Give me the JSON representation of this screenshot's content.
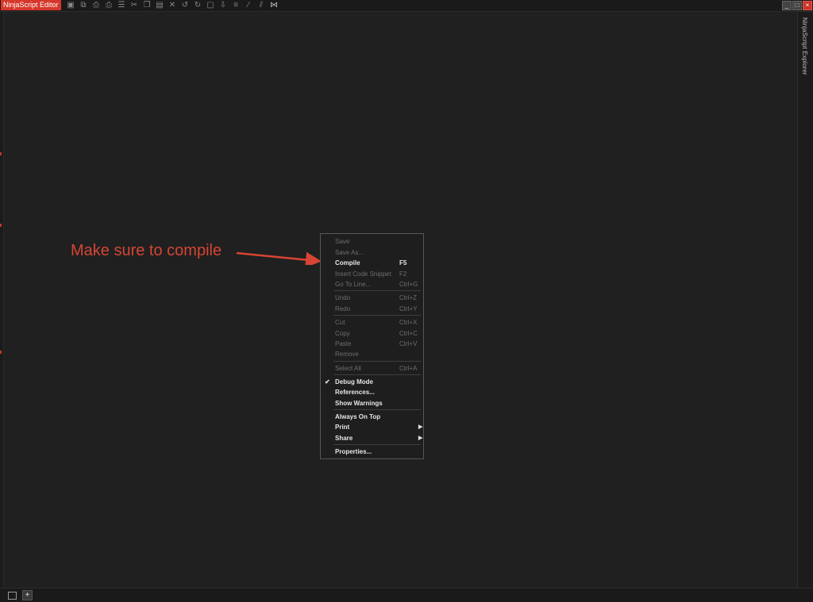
{
  "titlebar": {
    "app_title": "NinjaScript Editor",
    "toolbar_icons": [
      "save-icon",
      "save-all-icon",
      "print-icon",
      "print-preview-icon",
      "document-icon",
      "cut-icon",
      "copy-icon",
      "paste-icon",
      "delete-icon",
      "undo-icon",
      "redo-icon",
      "new-doc-icon",
      "insert-icon",
      "indent-icon",
      "comment-icon",
      "uncomment-icon",
      "visual-studio-icon"
    ]
  },
  "right_panel": {
    "tab_label": "NinjaScript Explorer"
  },
  "annotation": {
    "text": "Make sure to compile",
    "color": "#d64533"
  },
  "context_menu": {
    "items": [
      {
        "label": "Save",
        "shortcut": "",
        "enabled": false
      },
      {
        "label": "Save As...",
        "shortcut": "",
        "enabled": false
      },
      {
        "label": "Compile",
        "shortcut": "F5",
        "enabled": true
      },
      {
        "label": "Insert Code Snippet",
        "shortcut": "F2",
        "enabled": false
      },
      {
        "label": "Go To Line...",
        "shortcut": "Ctrl+G",
        "enabled": false
      },
      {
        "label": "Undo",
        "shortcut": "Ctrl+Z",
        "enabled": false
      },
      {
        "label": "Redo",
        "shortcut": "Ctrl+Y",
        "enabled": false
      },
      {
        "label": "Cut",
        "shortcut": "Ctrl+X",
        "enabled": false
      },
      {
        "label": "Copy",
        "shortcut": "Ctrl+C",
        "enabled": false
      },
      {
        "label": "Paste",
        "shortcut": "Ctrl+V",
        "enabled": false
      },
      {
        "label": "Remove",
        "shortcut": "",
        "enabled": false
      },
      {
        "label": "Select All",
        "shortcut": "Ctrl+A",
        "enabled": false
      },
      {
        "label": "Debug Mode",
        "shortcut": "",
        "enabled": true,
        "checked": true
      },
      {
        "label": "References...",
        "shortcut": "",
        "enabled": true
      },
      {
        "label": "Show Warnings",
        "shortcut": "",
        "enabled": true
      },
      {
        "label": "Always On Top",
        "shortcut": "",
        "enabled": true
      },
      {
        "label": "Print",
        "shortcut": "",
        "enabled": true,
        "submenu": true
      },
      {
        "label": "Share",
        "shortcut": "",
        "enabled": true,
        "submenu": true
      },
      {
        "label": "Properties...",
        "shortcut": "",
        "enabled": true
      }
    ]
  },
  "colors": {
    "accent": "#d7372b",
    "background": "#202020",
    "menu_border": "#585858"
  }
}
